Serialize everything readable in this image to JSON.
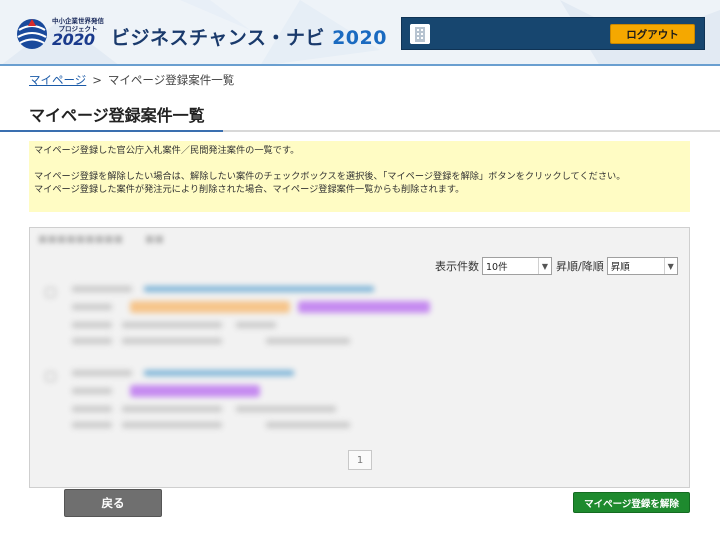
{
  "header": {
    "logo_small": "中小企業世界発信プロジェクト",
    "logo_year": "2020",
    "site_title": "ビジネスチャンス・ナビ",
    "site_title_year": "2020",
    "logout_label": "ログアウト",
    "icons": {
      "logo": "globe-logo-icon",
      "building": "building-icon"
    },
    "colors": {
      "user_bar": "#17466f",
      "logout": "#f5a800",
      "accent": "#3a6fb0"
    }
  },
  "breadcrumb": {
    "home": "マイページ",
    "separator": ">",
    "current": "マイページ登録案件一覧"
  },
  "page_title": "マイページ登録案件一覧",
  "notice": {
    "line1": "マイページ登録した官公庁入札案件／民間発注案件の一覧です。",
    "line2": "マイページ登録を解除したい場合は、解除したい案件のチェックボックスを選択後、「マイページ登録を解除」ボタンをクリックしてください。",
    "line3": "マイページ登録した案件が発注元により削除された場合、マイページ登録案件一覧からも削除されます。"
  },
  "list": {
    "display_count_label": "表示件数",
    "display_count_value": "10件",
    "sort_label": "昇順/降順",
    "sort_value": "昇順",
    "pager": [
      "1"
    ]
  },
  "buttons": {
    "back": "戻る",
    "unregister": "マイページ登録を解除",
    "colors": {
      "back": "#6f6f6f",
      "unregister": "#1e8a2e"
    }
  }
}
